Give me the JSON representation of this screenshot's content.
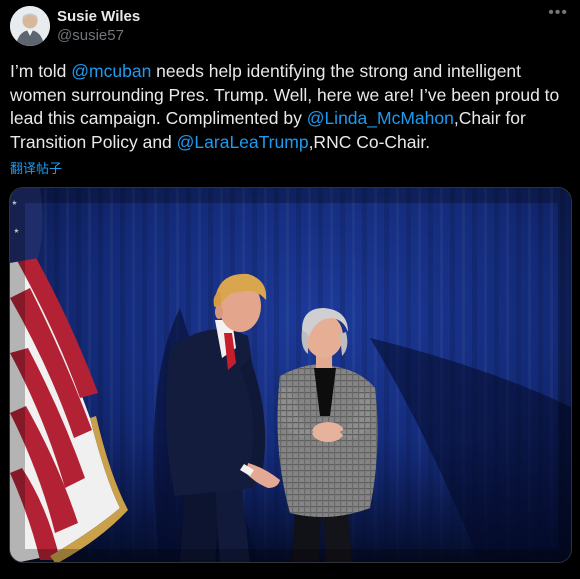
{
  "author": {
    "name": "Susie Wiles",
    "handle": "@susie57"
  },
  "tweet": {
    "segments": [
      {
        "text": "I’m told ",
        "mention": false
      },
      {
        "text": "@mcuban",
        "mention": true
      },
      {
        "text": " needs help identifying the strong and intelligent women surrounding Pres. Trump. Well, here we are! I’ve been proud to lead this campaign. Complimented by ",
        "mention": false
      },
      {
        "text": "@Linda_McMahon",
        "mention": true
      },
      {
        "text": ",Chair for Transition Policy and ",
        "mention": false
      },
      {
        "text": "@LaraLeaTrump",
        "mention": true
      },
      {
        "text": ",RNC Co-Chair.",
        "mention": false
      }
    ],
    "translate_label": "翻译帖子"
  },
  "icons": {
    "more": "more-horizontal-icon"
  },
  "colors": {
    "background": "#000000",
    "text": "#e7e9ea",
    "secondary": "#71767b",
    "accent": "#1d9bf0"
  }
}
